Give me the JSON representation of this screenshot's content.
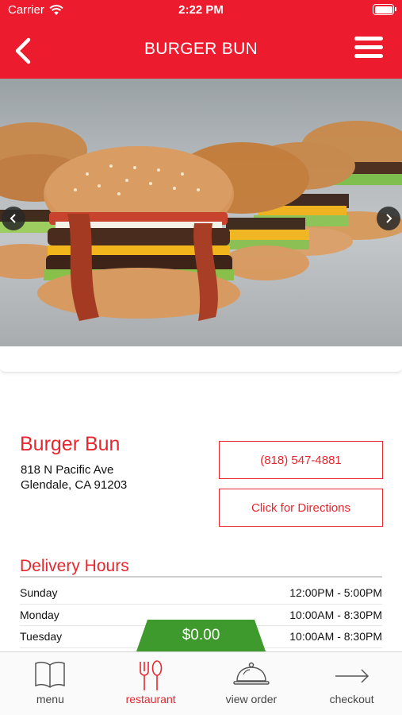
{
  "status_bar": {
    "carrier": "Carrier",
    "time": "2:22 PM"
  },
  "header": {
    "title": "BURGER BUN",
    "back_icon": "chevron-left-icon",
    "menu_icon": "hamburger-menu-icon"
  },
  "hero": {
    "image_subject": "burgers-photo",
    "prev_icon": "chevron-left-icon",
    "next_icon": "chevron-right-icon"
  },
  "restaurant": {
    "name": "Burger Bun",
    "address_line1": "818 N Pacific Ave",
    "address_line2": "Glendale, CA 91203",
    "phone": "(818) 547-4881",
    "directions_label": "Click for Directions"
  },
  "delivery_hours": {
    "title": "Delivery Hours",
    "rows": [
      {
        "day": "Sunday",
        "hours": "12:00PM - 5:00PM"
      },
      {
        "day": "Monday",
        "hours": "10:00AM - 8:30PM"
      },
      {
        "day": "Tuesday",
        "hours": "10:00AM - 8:30PM"
      }
    ]
  },
  "order": {
    "total": "$0.00"
  },
  "tabbar": {
    "items": [
      {
        "label": "menu",
        "icon": "book-icon",
        "active": false
      },
      {
        "label": "restaurant",
        "icon": "fork-knife-icon",
        "active": true
      },
      {
        "label": "view order",
        "icon": "cloche-icon",
        "active": false
      },
      {
        "label": "checkout",
        "icon": "arrow-right-icon",
        "active": false
      }
    ]
  },
  "colors": {
    "brand_red": "#ec1c2e",
    "accent_red": "#e8262f",
    "total_green": "#3f9a2e"
  }
}
